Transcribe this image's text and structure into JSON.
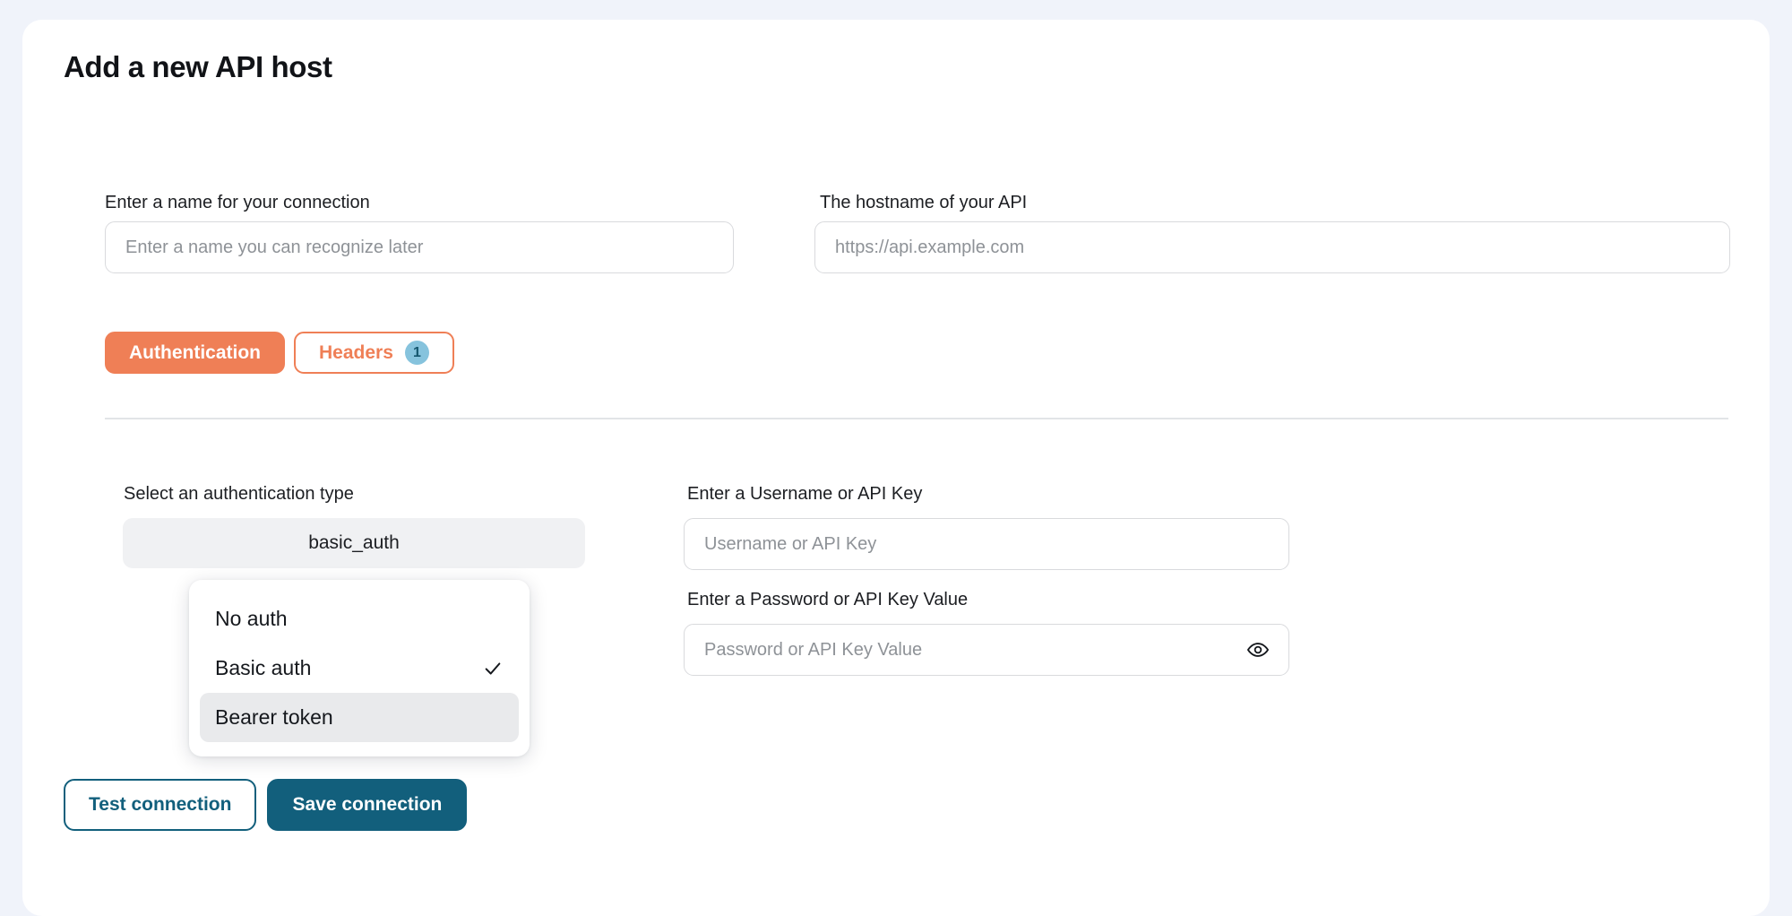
{
  "page": {
    "background_color": "#f0f3fa",
    "card_background": "#ffffff"
  },
  "header": {
    "title": "Add a new API host"
  },
  "connection": {
    "name_label": "Enter a name for your connection",
    "name_placeholder": "Enter a name you can recognize later",
    "name_value": "",
    "host_label": "The hostname of your API",
    "host_placeholder": "https://api.example.com",
    "host_value": ""
  },
  "tabs": [
    {
      "label": "Authentication",
      "active": true,
      "badge": null
    },
    {
      "label": "Headers",
      "active": false,
      "badge": "1"
    }
  ],
  "auth": {
    "type_label": "Select an authentication type",
    "selected_value": "basic_auth",
    "options": [
      {
        "label": "No auth",
        "checked": false,
        "hovered": false
      },
      {
        "label": "Basic auth",
        "checked": true,
        "hovered": false
      },
      {
        "label": "Bearer token",
        "checked": false,
        "hovered": true
      }
    ],
    "username_label": "Enter a Username or API Key",
    "username_placeholder": "Username or API Key",
    "username_value": "",
    "password_label": "Enter a Password or API Key Value",
    "password_placeholder": "Password or API Key Value",
    "password_value": ""
  },
  "footer": {
    "test_label": "Test connection",
    "save_label": "Save connection"
  },
  "colors": {
    "accent_orange": "#ef7f56",
    "badge_blue": "#86c3dd",
    "teal": "#125f7c",
    "select_bg": "#f0f1f3"
  }
}
